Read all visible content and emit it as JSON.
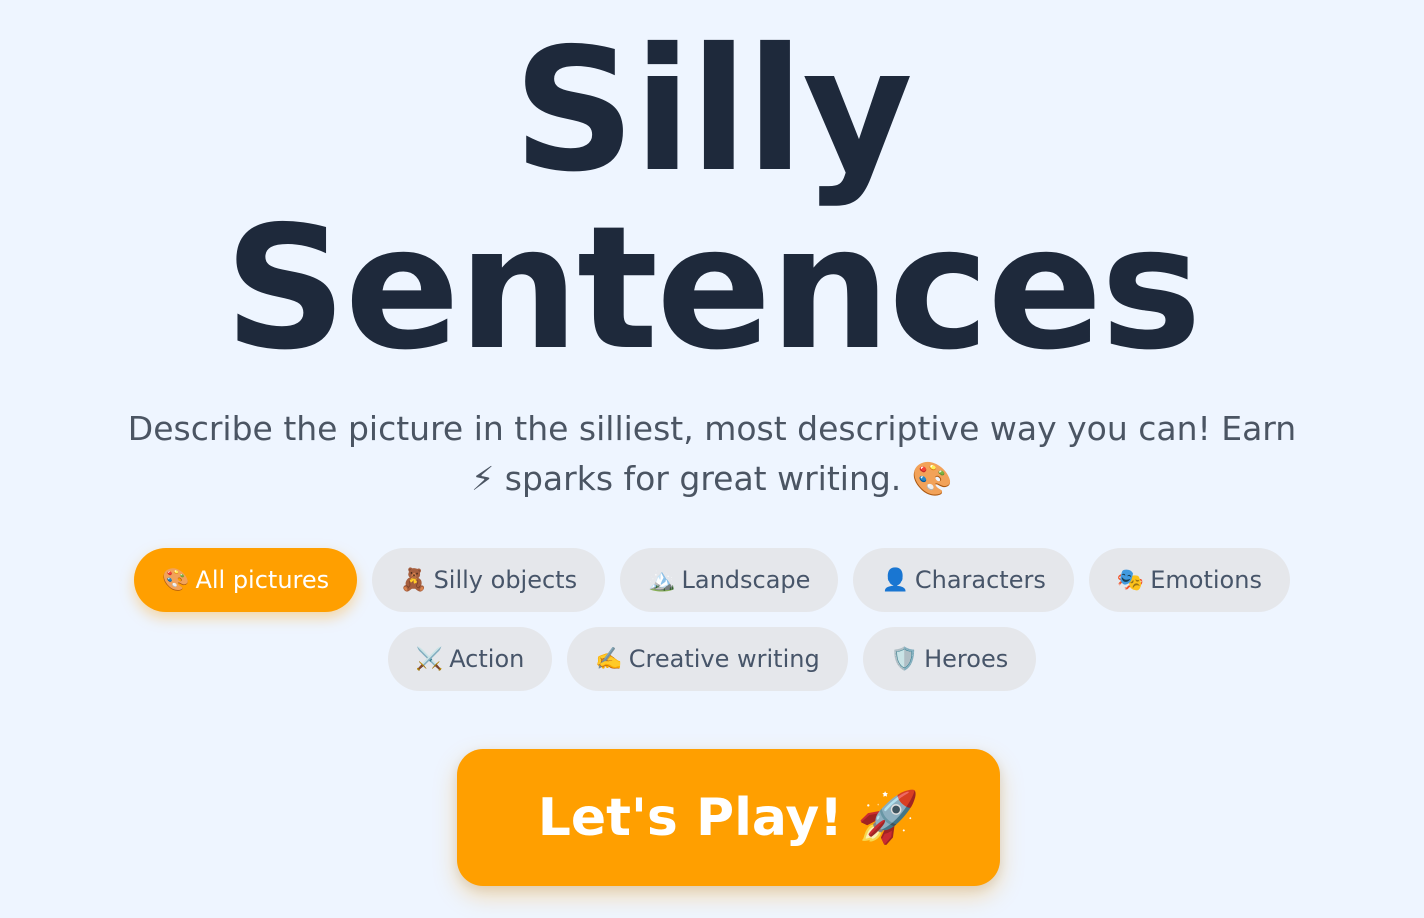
{
  "title": {
    "line1": "Silly",
    "line2": "Sentences"
  },
  "subtitle": {
    "before": "Describe the picture in the silliest, most descriptive way you can! Earn",
    "spark_icon": "⚡",
    "after": "sparks for great writing.",
    "palette_icon": "🎨"
  },
  "categories": [
    {
      "icon": "🎨",
      "label": "All pictures",
      "active": true
    },
    {
      "icon": "🧸",
      "label": "Silly objects",
      "active": false
    },
    {
      "icon": "🏔️",
      "label": "Landscape",
      "active": false
    },
    {
      "icon": "👤",
      "label": "Characters",
      "active": false
    },
    {
      "icon": "🎭",
      "label": "Emotions",
      "active": false
    },
    {
      "icon": "⚔️",
      "label": "Action",
      "active": false
    },
    {
      "icon": "✍️",
      "label": "Creative writing",
      "active": false
    },
    {
      "icon": "🛡️",
      "label": "Heroes",
      "active": false
    }
  ],
  "play_button": {
    "label": "Let's Play!",
    "icon": "🚀"
  },
  "colors": {
    "background": "#eef5ff",
    "accent": "#ff9f00",
    "title": "#1e293b",
    "chip_bg": "#e5e7eb"
  }
}
